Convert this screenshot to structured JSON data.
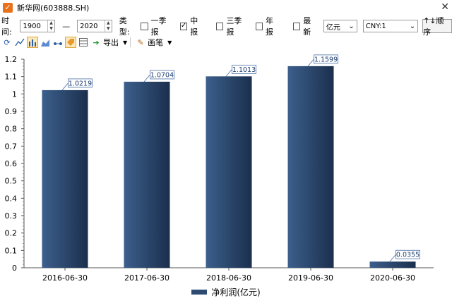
{
  "window": {
    "title": "新华网(603888.SH)",
    "close_glyph": "✕"
  },
  "toolbar1": {
    "time_label": "时间:",
    "start_year": "1900",
    "dash": "—",
    "end_year": "2020",
    "type_label": "类型:",
    "report_types": [
      {
        "label": "一季报",
        "checked": false
      },
      {
        "label": "中报",
        "checked": true
      },
      {
        "label": "三季报",
        "checked": false
      },
      {
        "label": "年报",
        "checked": false
      }
    ],
    "latest_label": "最新",
    "unit_select": "亿元",
    "currency_select": "CNY:1",
    "sort_button": "↑↓顺序"
  },
  "toolbar2": {
    "export_label": "导出",
    "brush_label": "画笔",
    "icons": [
      "refresh-icon",
      "line-chart-icon",
      "bar-chart-icon",
      "area-chart-icon",
      "scatter-icon",
      "tag-icon",
      "table-icon"
    ]
  },
  "chart_data": {
    "type": "bar",
    "categories": [
      "2016-06-30",
      "2017-06-30",
      "2018-06-30",
      "2019-06-30",
      "2020-06-30"
    ],
    "series": [
      {
        "name": "净利润(亿元)",
        "values": [
          1.0219,
          1.0704,
          1.1013,
          1.1599,
          0.0355
        ]
      }
    ],
    "ylim": [
      0,
      1.2
    ],
    "yticks": [
      "0",
      "0.1",
      "0.2",
      "0.3",
      "0.4",
      "0.5",
      "0.6",
      "0.7",
      "0.8",
      "0.9",
      "1",
      "1.1",
      "1.2"
    ],
    "data_labels": [
      "1.0219",
      "1.0704",
      "1.1013",
      "1.1599",
      "0.0355"
    ],
    "legend_position": "bottom",
    "colors": {
      "bar_left": "#3c5f8c",
      "bar_right": "#1b2f4d",
      "label_border": "#4a6fa5"
    }
  }
}
